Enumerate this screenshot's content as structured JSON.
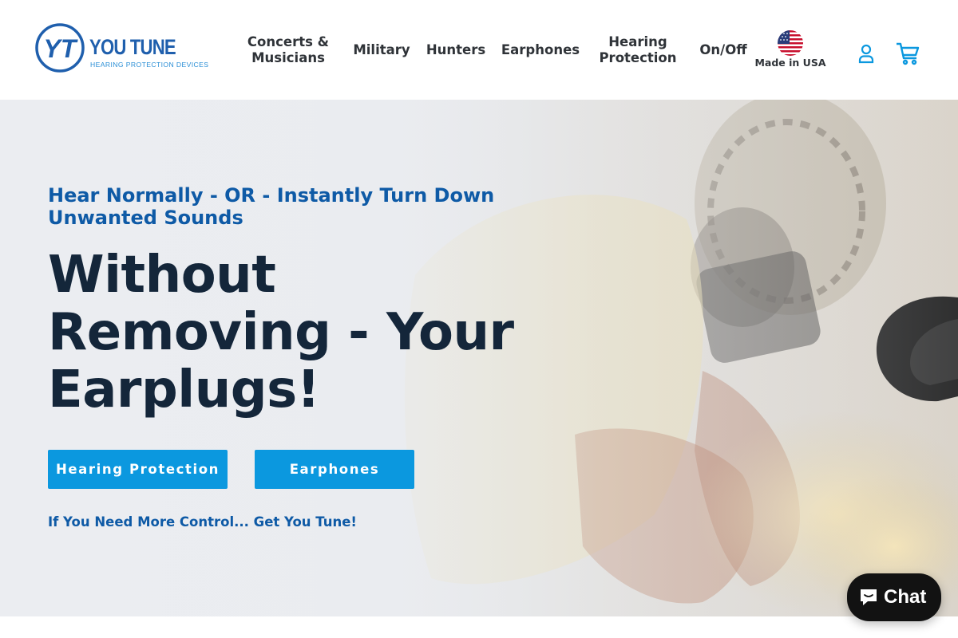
{
  "logo": {
    "brand": "YOU TUNE",
    "tagline": "HEARING PROTECTION DEVICES"
  },
  "nav": {
    "concerts": [
      "Concerts &",
      "Musicians"
    ],
    "military": "Military",
    "hunters": "Hunters",
    "earphones": "Earphones",
    "hearing_protection": [
      "Hearing",
      "Protection"
    ],
    "onoff": "On/Off",
    "made_in_usa": "Made in USA"
  },
  "icons": {
    "account": "user-icon",
    "cart": "cart-icon",
    "flag": "us-flag-icon",
    "chat": "chat-bubble-icon"
  },
  "hero": {
    "eyebrow": "Hear Normally - OR - Instantly Turn Down Unwanted Sounds",
    "headline": "Without Removing - Your Earplugs!",
    "buttons": {
      "hearing_protection": "Hearing Protection",
      "earphones": "Earphones"
    },
    "cta": "If You Need More Control... Get You Tune!"
  },
  "chat": {
    "label": "Chat"
  },
  "colors": {
    "brand_blue": "#0e5aa6",
    "button_blue": "#0b98df",
    "headline": "#14263a",
    "nav_text": "#2f3338"
  }
}
